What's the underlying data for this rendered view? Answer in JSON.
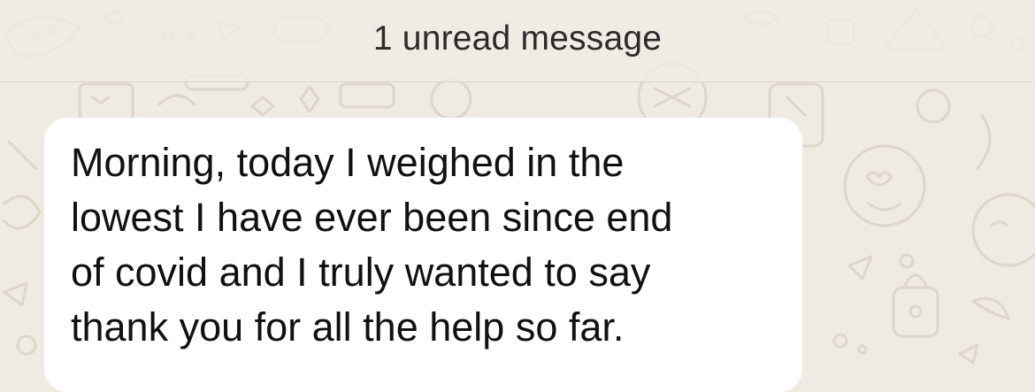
{
  "chat": {
    "unread_banner": "1 unread message",
    "messages": [
      {
        "direction": "incoming",
        "text": "Morning, today I weighed in the\nlowest I have ever been since end\nof covid and I truly wanted to say\nthank you for all the help so far."
      }
    ]
  },
  "colors": {
    "background": "#efeae2",
    "banner": "#f0ece4",
    "bubble": "#ffffff",
    "text": "#111111",
    "doodle": "#ddd6cb"
  }
}
